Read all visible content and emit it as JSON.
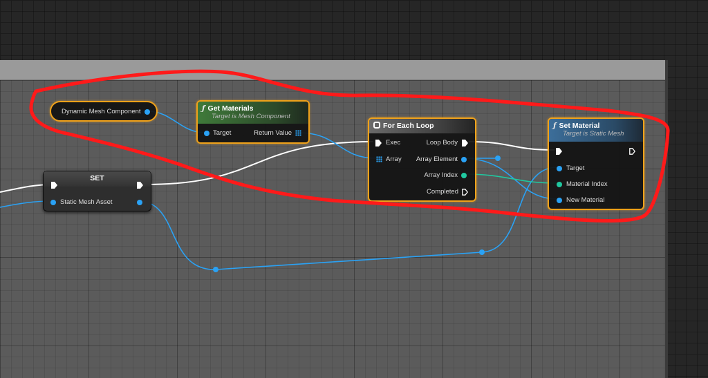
{
  "panel": {
    "header_text": ""
  },
  "nodes": {
    "dynamic_mesh": {
      "label": "Dynamic Mesh Component"
    },
    "get_materials": {
      "title": "Get Materials",
      "subtitle": "Target is Mesh Component",
      "target": "Target",
      "return_value": "Return Value"
    },
    "for_each": {
      "title": "For Each Loop",
      "exec": "Exec",
      "array": "Array",
      "loop_body": "Loop Body",
      "array_element": "Array Element",
      "array_index": "Array Index",
      "completed": "Completed"
    },
    "set_var": {
      "title": "SET",
      "static_mesh_asset": "Static Mesh Asset"
    },
    "set_material": {
      "title": "Set Material",
      "subtitle": "Target is Static Mesh",
      "target": "Target",
      "material_index": "Material Index",
      "new_material": "New Material"
    }
  },
  "icons": {
    "function": "function-icon",
    "loop": "loop-icon",
    "exec": "exec-pin-icon",
    "object": "object-pin-icon",
    "array": "array-pin-icon",
    "integer": "integer-pin-icon"
  },
  "colors": {
    "object_pin": "#2aa2f5",
    "integer_pin": "#20c8a0",
    "exec_wire": "#ffffff",
    "selection": "#f0a21a",
    "annotation": "#ff1a1a"
  }
}
